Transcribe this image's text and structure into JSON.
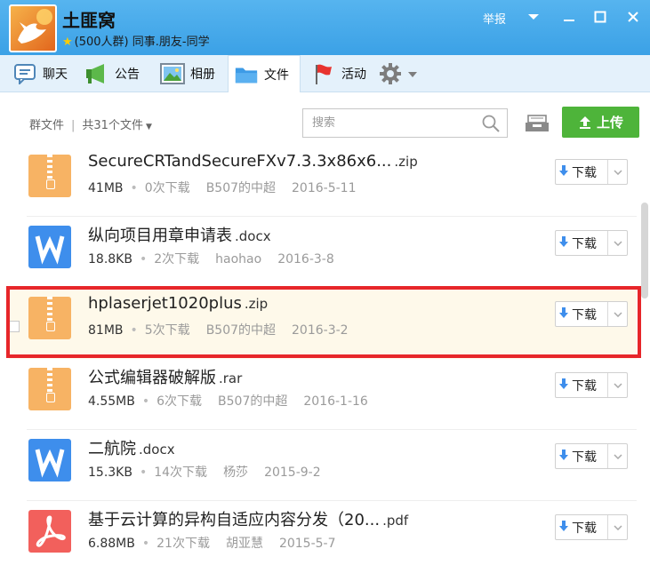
{
  "window": {
    "group_name": "土匪窝",
    "group_meta": "(500人群) 同事.朋友-同学",
    "report_label": "举报"
  },
  "tabs": [
    {
      "label": "聊天",
      "icon": "chat-icon"
    },
    {
      "label": "公告",
      "icon": "megaphone-icon"
    },
    {
      "label": "相册",
      "icon": "photo-icon"
    },
    {
      "label": "文件",
      "icon": "folder-icon",
      "active": true
    },
    {
      "label": "活动",
      "icon": "flag-icon"
    },
    {
      "label": "",
      "icon": "gear-icon"
    }
  ],
  "toolbar": {
    "group_files": "群文件",
    "total_files": "共31个文件",
    "search_placeholder": "搜索",
    "upload_label": "上传"
  },
  "files": [
    {
      "name": "SecureCRTandSecureFXv7.3.3x86x6...",
      "ext": ".zip",
      "type": "zip",
      "size": "41MB",
      "downloads": "0次下载",
      "uploader": "B507的中超",
      "date": "2016-5-11"
    },
    {
      "name": "纵向项目用章申请表",
      "ext": ".docx",
      "type": "doc",
      "size": "18.8KB",
      "downloads": "2次下载",
      "uploader": "haohao",
      "date": "2016-3-8"
    },
    {
      "name": "hplaserjet1020plus",
      "ext": ".zip",
      "type": "zip",
      "size": "81MB",
      "downloads": "5次下载",
      "uploader": "B507的中超",
      "date": "2016-3-2",
      "highlighted": true
    },
    {
      "name": "公式编辑器破解版",
      "ext": ".rar",
      "type": "zip",
      "size": "4.55MB",
      "downloads": "6次下载",
      "uploader": "B507的中超",
      "date": "2016-1-16"
    },
    {
      "name": "二航院",
      "ext": ".docx",
      "type": "doc",
      "size": "15.3KB",
      "downloads": "14次下载",
      "uploader": "杨莎",
      "date": "2015-9-2"
    },
    {
      "name": "基于云计算的异构自适应内容分发（20...",
      "ext": ".pdf",
      "type": "pdf",
      "size": "6.88MB",
      "downloads": "21次下载",
      "uploader": "胡亚慧",
      "date": "2015-5-7"
    }
  ],
  "download_label": "下载",
  "colors": {
    "titlebar": "#3ba1e6",
    "upload": "#4eb43a",
    "highlight_border": "#e7262a",
    "zip": "#f7b364",
    "doc": "#3e8eec",
    "pdf": "#f2605c"
  }
}
